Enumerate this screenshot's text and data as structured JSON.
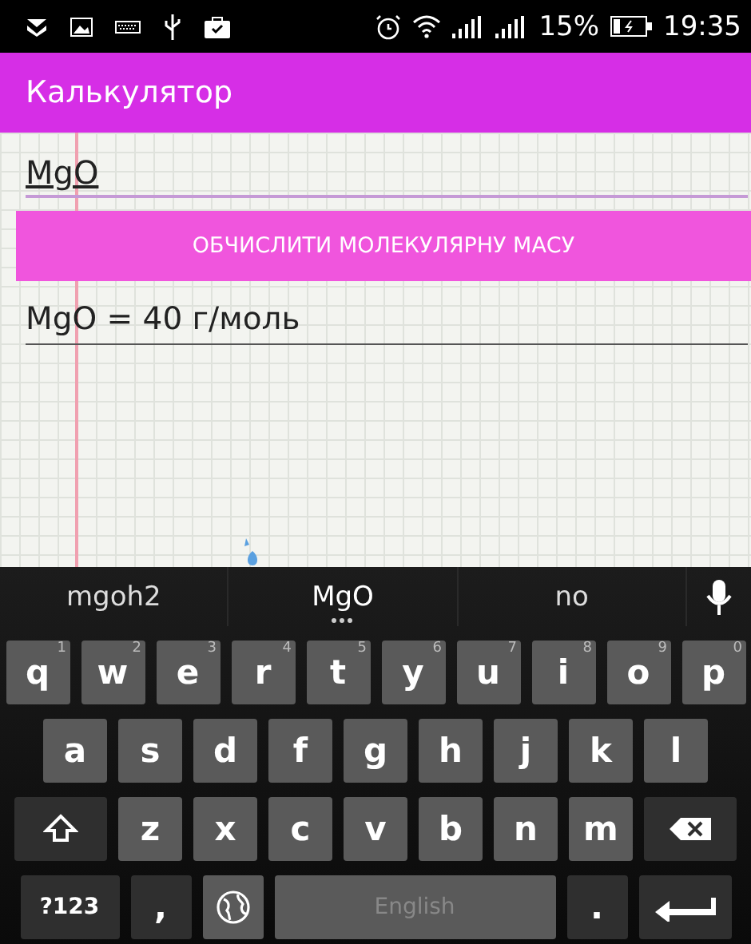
{
  "status_bar": {
    "battery": "15%",
    "time": "19:35"
  },
  "app_bar": {
    "title": "Калькулятор"
  },
  "formula_field": {
    "value": "MgO"
  },
  "calculate_button": {
    "label": "ОБЧИСЛИТИ МОЛЕКУЛЯРНУ МАСУ"
  },
  "result": {
    "text": "MgO = 40 г/моль"
  },
  "keyboard": {
    "suggestions": [
      {
        "text": "mgoh2",
        "selected": false
      },
      {
        "text": "MgO",
        "selected": true
      },
      {
        "text": "no",
        "selected": false
      }
    ],
    "rows": [
      {
        "keys": [
          {
            "kind": "letter",
            "label": "q",
            "hint": "1"
          },
          {
            "kind": "letter",
            "label": "w",
            "hint": "2"
          },
          {
            "kind": "letter",
            "label": "e",
            "hint": "3"
          },
          {
            "kind": "letter",
            "label": "r",
            "hint": "4"
          },
          {
            "kind": "letter",
            "label": "t",
            "hint": "5"
          },
          {
            "kind": "letter",
            "label": "y",
            "hint": "6"
          },
          {
            "kind": "letter",
            "label": "u",
            "hint": "7"
          },
          {
            "kind": "letter",
            "label": "i",
            "hint": "8"
          },
          {
            "kind": "letter",
            "label": "o",
            "hint": "9"
          },
          {
            "kind": "letter",
            "label": "p",
            "hint": "0"
          }
        ]
      },
      {
        "keys": [
          {
            "kind": "letter",
            "label": "a"
          },
          {
            "kind": "letter",
            "label": "s"
          },
          {
            "kind": "letter",
            "label": "d"
          },
          {
            "kind": "letter",
            "label": "f"
          },
          {
            "kind": "letter",
            "label": "g"
          },
          {
            "kind": "letter",
            "label": "h"
          },
          {
            "kind": "letter",
            "label": "j"
          },
          {
            "kind": "letter",
            "label": "k"
          },
          {
            "kind": "letter",
            "label": "l"
          }
        ]
      },
      {
        "keys": [
          {
            "kind": "shift"
          },
          {
            "kind": "letter",
            "label": "z"
          },
          {
            "kind": "letter",
            "label": "x"
          },
          {
            "kind": "letter",
            "label": "c"
          },
          {
            "kind": "letter",
            "label": "v"
          },
          {
            "kind": "letter",
            "label": "b"
          },
          {
            "kind": "letter",
            "label": "n"
          },
          {
            "kind": "letter",
            "label": "m"
          },
          {
            "kind": "delete"
          }
        ]
      },
      {
        "keys": [
          {
            "kind": "symbols",
            "label": "?123"
          },
          {
            "kind": "punct",
            "label": ","
          },
          {
            "kind": "globe"
          },
          {
            "kind": "space",
            "label": "English"
          },
          {
            "kind": "punct",
            "label": "."
          },
          {
            "kind": "enter"
          }
        ]
      }
    ]
  }
}
